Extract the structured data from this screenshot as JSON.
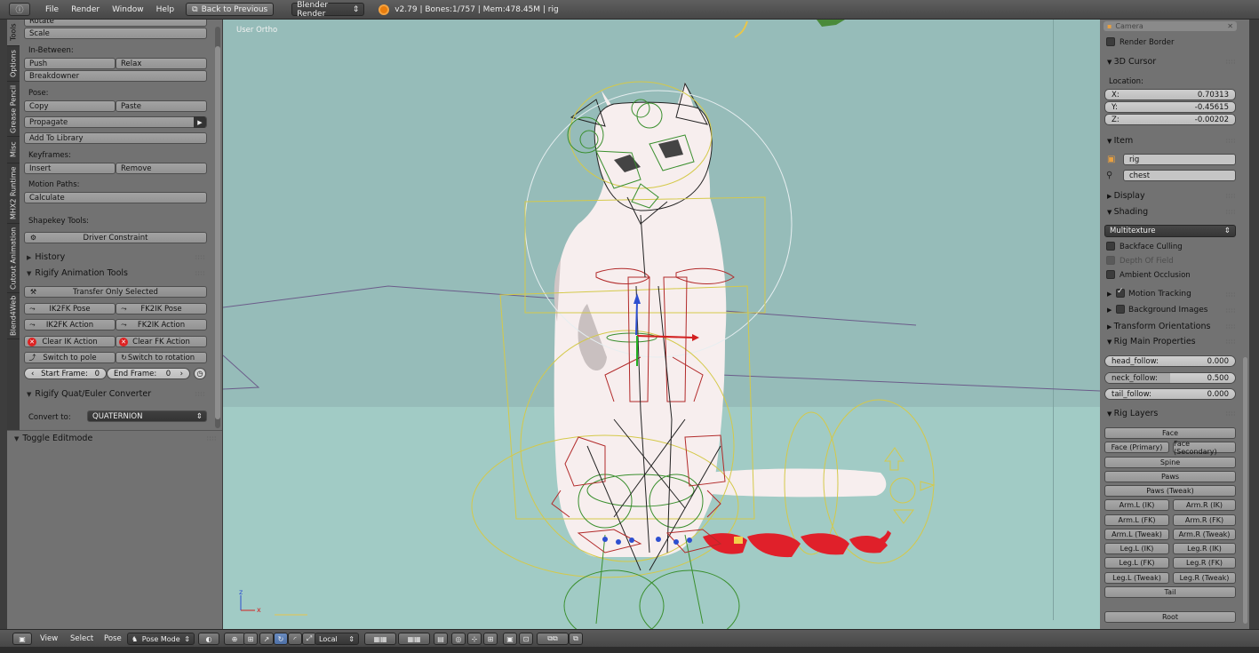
{
  "top_menu": {
    "editor_icon": "info-icon",
    "items": [
      "File",
      "Render",
      "Window",
      "Help"
    ],
    "back_button": "Back to Previous",
    "engine": "Blender Render",
    "stats": "v2.79 | Bones:1/757 | Mem:478.45M | rig"
  },
  "left_tabs": [
    "Tools",
    "Options",
    "Grease Pencil",
    "Misc",
    "MHX2 Runtime",
    "Cutout Animation",
    "Blend4Web"
  ],
  "tool_shelf": {
    "rotate": "Rotate",
    "scale": "Scale",
    "in_between_label": "In-Between:",
    "push": "Push",
    "relax": "Relax",
    "breakdowner": "Breakdowner",
    "pose_label": "Pose:",
    "copy": "Copy",
    "paste": "Paste",
    "propagate": "Propagate",
    "add_to_library": "Add To Library",
    "keyframes_label": "Keyframes:",
    "insert": "Insert",
    "remove": "Remove",
    "motion_paths_label": "Motion Paths:",
    "calculate": "Calculate",
    "shapekey_label": "Shapekey Tools:",
    "driver_constraint": "Driver Constraint",
    "history": "History",
    "rigify_anim_tools": "Rigify Animation Tools",
    "transfer_only_selected": "Transfer Only Selected",
    "ik2fk_pose": "IK2FK Pose",
    "fk2ik_pose": "FK2IK Pose",
    "ik2fk_action": "IK2FK Action",
    "fk2ik_action": "FK2IK Action",
    "clear_ik_action": "Clear IK Action",
    "clear_fk_action": "Clear FK Action",
    "switch_to_pole": "Switch to pole",
    "switch_to_rotation": "Switch to rotation",
    "start_frame_label": "Start Frame:",
    "start_frame_value": "0",
    "end_frame_label": "End Frame:",
    "end_frame_value": "0",
    "quat_euler": "Rigify Quat/Euler Converter",
    "convert_to_label": "Convert to:",
    "convert_to_value": "QUATERNION",
    "toggle_editmode": "Toggle Editmode"
  },
  "viewport": {
    "view_label": "User Ortho",
    "axis_z": "z",
    "axis_x": "x",
    "colors": {
      "background": "#96bcb9",
      "floor": "#a1cbc5"
    }
  },
  "properties": {
    "camera_label": "Camera",
    "render_border": "Render Border",
    "cursor_header": "3D Cursor",
    "location_label": "Location:",
    "x_label": "X:",
    "x_value": "0.70313",
    "y_label": "Y:",
    "y_value": "-0.45615",
    "z_label": "Z:",
    "z_value": "-0.00202",
    "item_header": "Item",
    "item_object": "rig",
    "item_bone": "chest",
    "display_header": "Display",
    "shading_header": "Shading",
    "shading_mode": "Multitexture",
    "backface_culling": "Backface Culling",
    "depth_of_field": "Depth Of Field",
    "ambient_occlusion": "Ambient Occlusion",
    "motion_tracking": "Motion Tracking",
    "background_images": "Background Images",
    "transform_orientations": "Transform Orientations",
    "rig_main_props": "Rig Main Properties",
    "head_follow_label": "head_follow:",
    "head_follow_value": "0.000",
    "head_follow_fraction": 0.0,
    "neck_follow_label": "neck_follow:",
    "neck_follow_value": "0.500",
    "neck_follow_fraction": 0.5,
    "tail_follow_label": "tail_follow:",
    "tail_follow_value": "0.000",
    "tail_follow_fraction": 0.0,
    "rig_layers_header": "Rig Layers",
    "layers": {
      "face": "Face",
      "face_primary": "Face (Primary)",
      "face_secondary": "Face (Secondary)",
      "spine": "Spine",
      "paws": "Paws",
      "paws_tweak": "Paws (Tweak)",
      "arm_l_ik": "Arm.L (IK)",
      "arm_r_ik": "Arm.R (IK)",
      "arm_l_fk": "Arm.L (FK)",
      "arm_r_fk": "Arm.R (FK)",
      "arm_l_tweak": "Arm.L (Tweak)",
      "arm_r_tweak": "Arm.R (Tweak)",
      "leg_l_ik": "Leg.L (IK)",
      "leg_r_ik": "Leg.R (IK)",
      "leg_l_fk": "Leg.L (FK)",
      "leg_r_fk": "Leg.R (FK)",
      "leg_l_tweak": "Leg.L (Tweak)",
      "leg_r_tweak": "Leg.R (Tweak)",
      "tail": "Tail",
      "root": "Root"
    }
  },
  "bottom_bar": {
    "view": "View",
    "select": "Select",
    "pose": "Pose",
    "mode": "Pose Mode",
    "orientation": "Local"
  }
}
